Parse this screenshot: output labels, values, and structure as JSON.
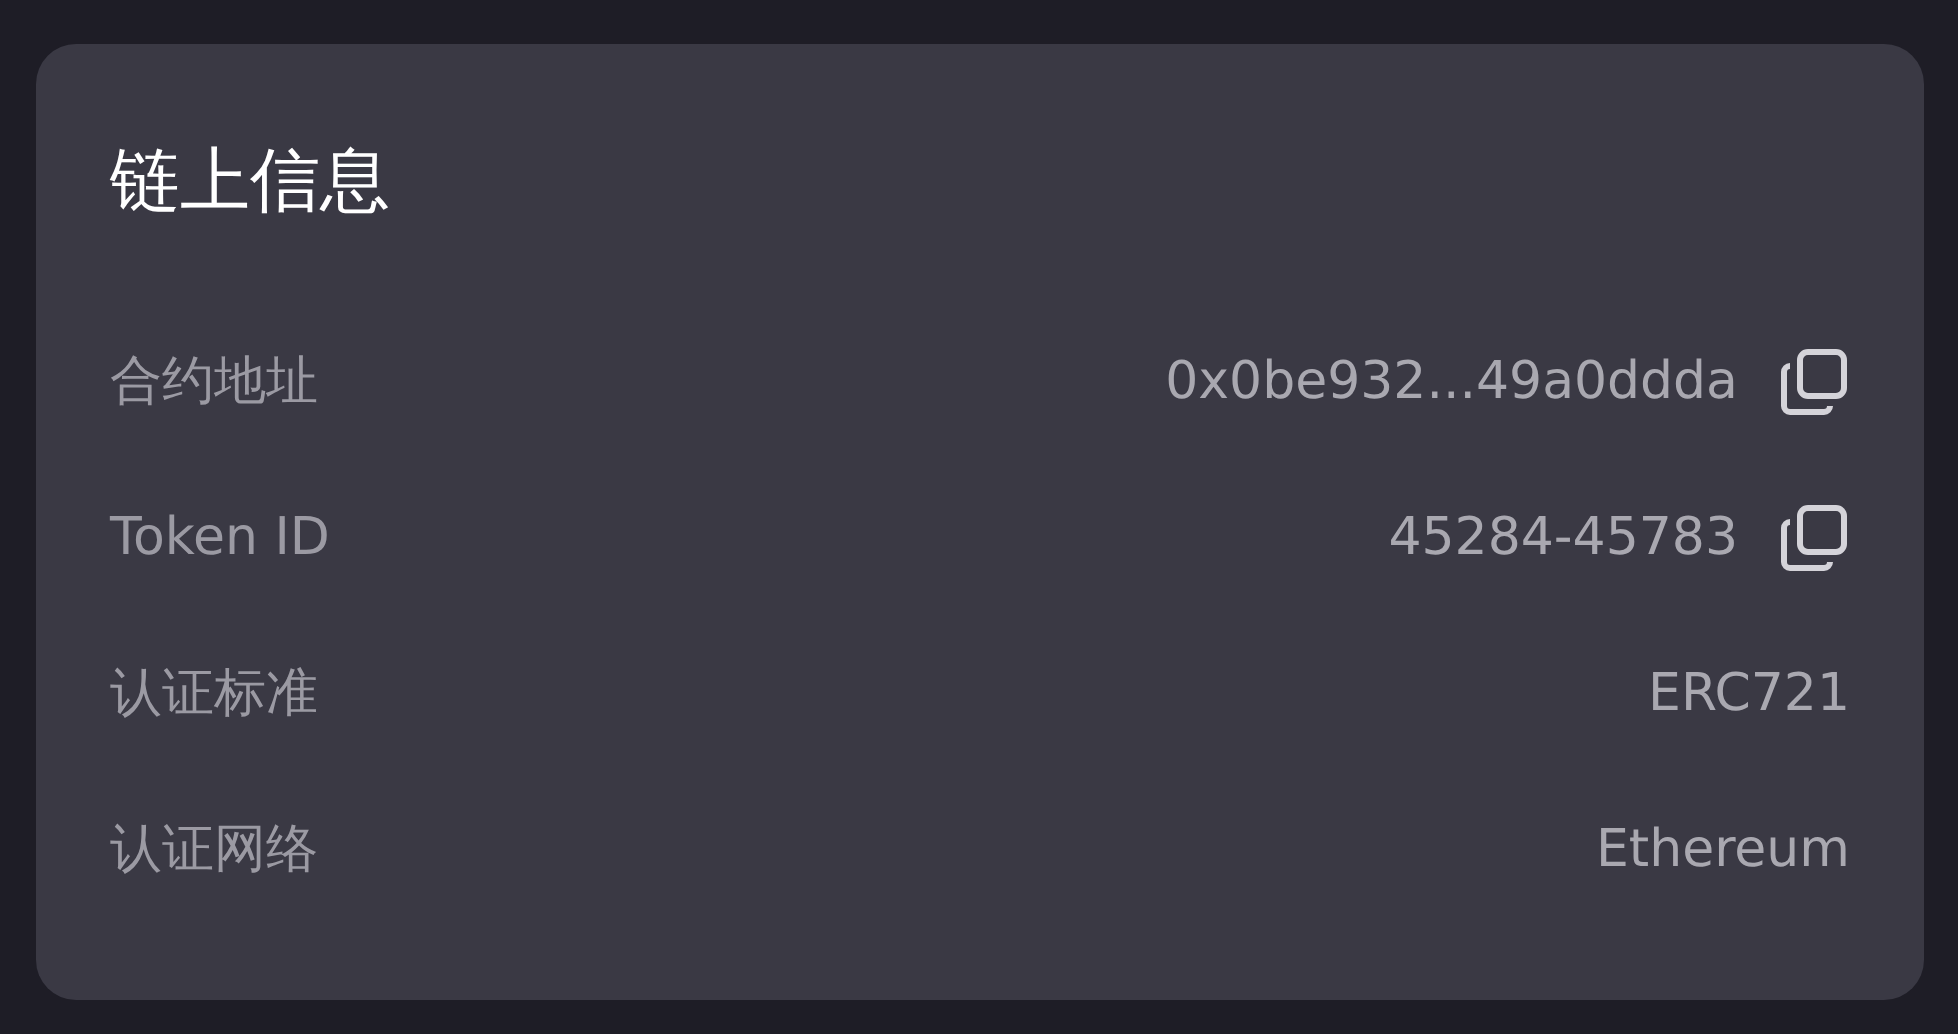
{
  "card": {
    "title": "链上信息",
    "rows": [
      {
        "label": "合约地址",
        "value": "0x0be932...49a0ddda",
        "copyable": true
      },
      {
        "label": "Token ID",
        "value": "45284-45783",
        "copyable": true
      },
      {
        "label": "认证标准",
        "value": "ERC721",
        "copyable": false
      },
      {
        "label": "认证网络",
        "value": "Ethereum",
        "copyable": false
      }
    ]
  }
}
